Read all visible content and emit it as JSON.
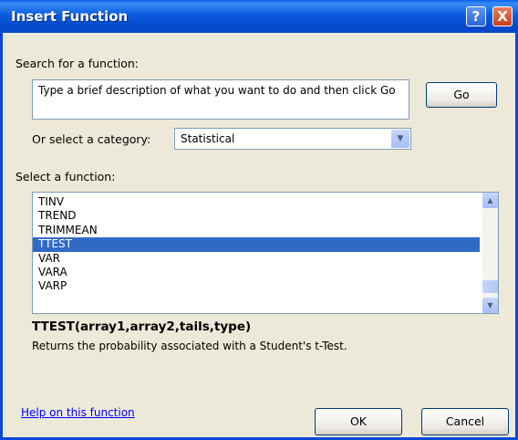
{
  "dialog": {
    "title": "Insert Function",
    "help_button": "?",
    "close_button": "X"
  },
  "search": {
    "label": "Search for a function:",
    "value": "Type a brief description of what you want to do and then click Go",
    "go_button": "Go"
  },
  "category": {
    "label": "Or select a category:",
    "selected": "Statistical"
  },
  "function_list": {
    "label": "Select a function:",
    "items": [
      "TINV",
      "TREND",
      "TRIMMEAN",
      "TTEST",
      "VAR",
      "VARA",
      "VARP"
    ],
    "selected": "TTEST"
  },
  "details": {
    "signature": "TTEST(array1,array2,tails,type)",
    "description": "Returns the probability associated with a Student's t-Test."
  },
  "footer": {
    "help_link": "Help on this function",
    "ok_button": "OK",
    "cancel_button": "Cancel"
  },
  "colors": {
    "titlebar": "#0b5ce0",
    "dialog_bg": "#ece9d8",
    "selection": "#316ac5",
    "link": "#0000ff"
  }
}
